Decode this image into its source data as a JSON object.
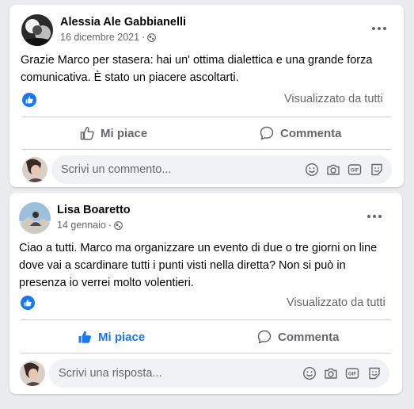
{
  "posts": [
    {
      "author": "Alessia Ale Gabbianelli",
      "date": "16 dicembre 2021",
      "separator": "·",
      "text": "Grazie Marco per stasera: hai un' ottima dialettica e una grande forza comunicativa. È stato un piacere ascoltarti.",
      "seen_label": "Visualizzato da tutti",
      "like_label": "Mi piace",
      "liked": false,
      "comment_label": "Commenta",
      "input_placeholder": "Scrivi un commento..."
    },
    {
      "author": "Lisa Boaretto",
      "date": "14 gennaio",
      "separator": "·",
      "text": "Ciao a tutti. Marco ma organizzare un evento di due o tre giorni on line dove vai a scardinare tutti i punti visti nella diretta? Non si può in presenza io verrei molto volentieri.",
      "seen_label": "Visualizzato da tutti",
      "like_label": "Mi piace",
      "liked": true,
      "comment_label": "Commenta",
      "input_placeholder": "Scrivi una risposta..."
    }
  ],
  "gif_label": "GIF",
  "colors": {
    "accent": "#1877f2",
    "secondary_text": "#65676b",
    "input_bg": "#f0f2f5",
    "page_bg": "#e9ebee"
  },
  "icons": [
    "globe-icon",
    "more-icon",
    "like-reaction-icon",
    "thumbs-up-icon",
    "comment-icon",
    "emoji-icon",
    "camera-icon",
    "gif-icon",
    "sticker-icon"
  ]
}
